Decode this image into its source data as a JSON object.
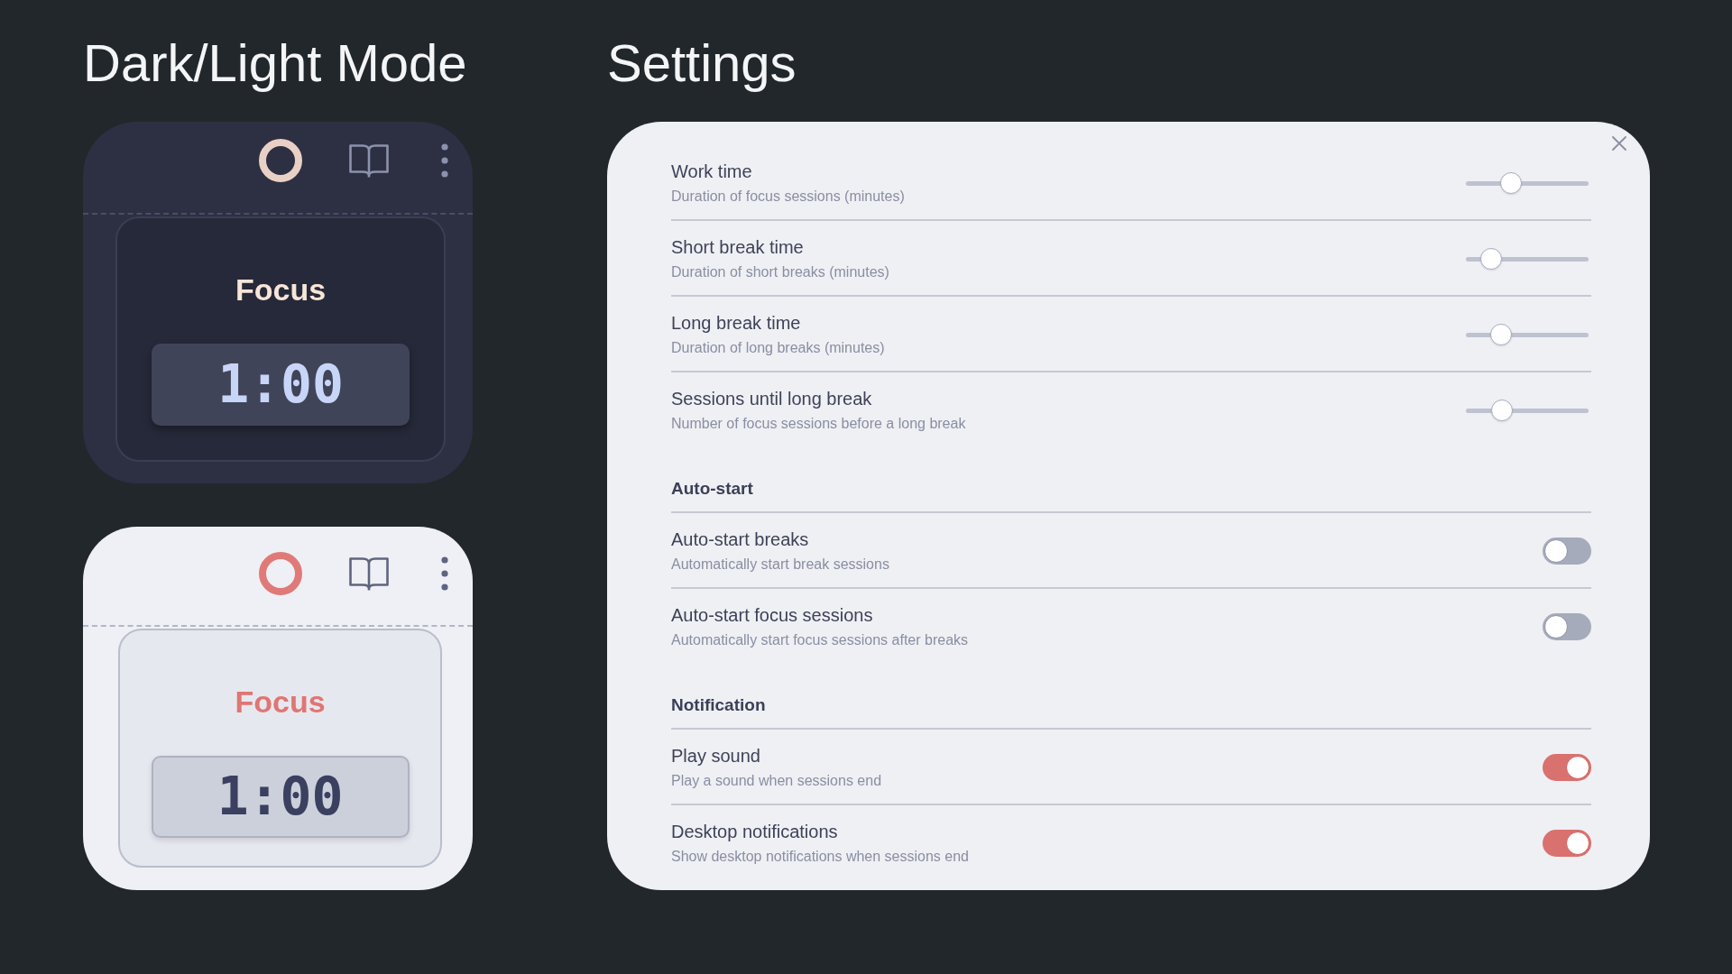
{
  "mode_previews": {
    "title": "Dark/Light Mode",
    "cards": [
      {
        "kind": "dark",
        "label": "Focus",
        "timer": "1:00"
      },
      {
        "kind": "light",
        "label": "Focus",
        "timer": "1:00"
      }
    ]
  },
  "settings": {
    "title": "Settings",
    "sections": [
      {
        "items": [
          {
            "kind": "slider",
            "title": "Work time",
            "description": "Duration of focus sessions (minutes)",
            "level": 0.34
          },
          {
            "kind": "slider",
            "title": "Short break time",
            "description": "Duration of short breaks (minutes)",
            "level": 0.14
          },
          {
            "kind": "slider",
            "title": "Long break time",
            "description": "Duration of long breaks (minutes)",
            "level": 0.24
          },
          {
            "kind": "slider",
            "title": "Sessions until long break",
            "description": "Number of focus sessions before a long break",
            "level": 0.25
          }
        ]
      },
      {
        "heading": "Auto-start",
        "items": [
          {
            "kind": "toggle",
            "title": "Auto-start breaks",
            "description": "Automatically start break sessions",
            "on": false
          },
          {
            "kind": "toggle",
            "title": "Auto-start focus sessions",
            "description": "Automatically start focus sessions after breaks",
            "on": false
          }
        ]
      },
      {
        "heading": "Notification",
        "items": [
          {
            "kind": "toggle",
            "title": "Play sound",
            "description": "Play a sound when sessions end",
            "on": true
          },
          {
            "kind": "toggle",
            "title": "Desktop notifications",
            "description": "Show desktop notifications when sessions end",
            "on": true
          }
        ]
      }
    ]
  }
}
